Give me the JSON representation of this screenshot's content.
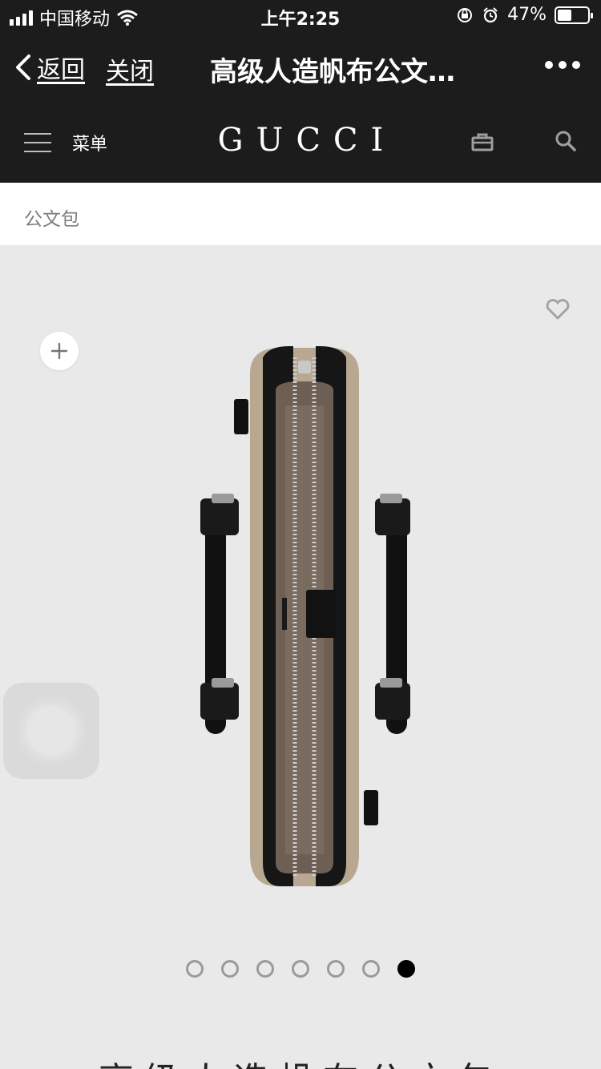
{
  "status_bar": {
    "carrier": "中国移动",
    "time": "上午2:25",
    "battery": "47%",
    "battery_level": 0.47,
    "icons": [
      "signal-icon",
      "wifi-icon",
      "orientation-lock-icon",
      "alarm-icon",
      "battery-icon"
    ]
  },
  "wechat_nav": {
    "back_label": "返回",
    "close_label": "关闭",
    "title": "高级人造帆布公文…"
  },
  "site_header": {
    "menu_label": "菜单",
    "logo": "GUCCI"
  },
  "breadcrumb": {
    "label": "公文包"
  },
  "gallery": {
    "image_count": 7,
    "active_index": 6
  },
  "product": {
    "title": "高级人造帆布公文包"
  }
}
